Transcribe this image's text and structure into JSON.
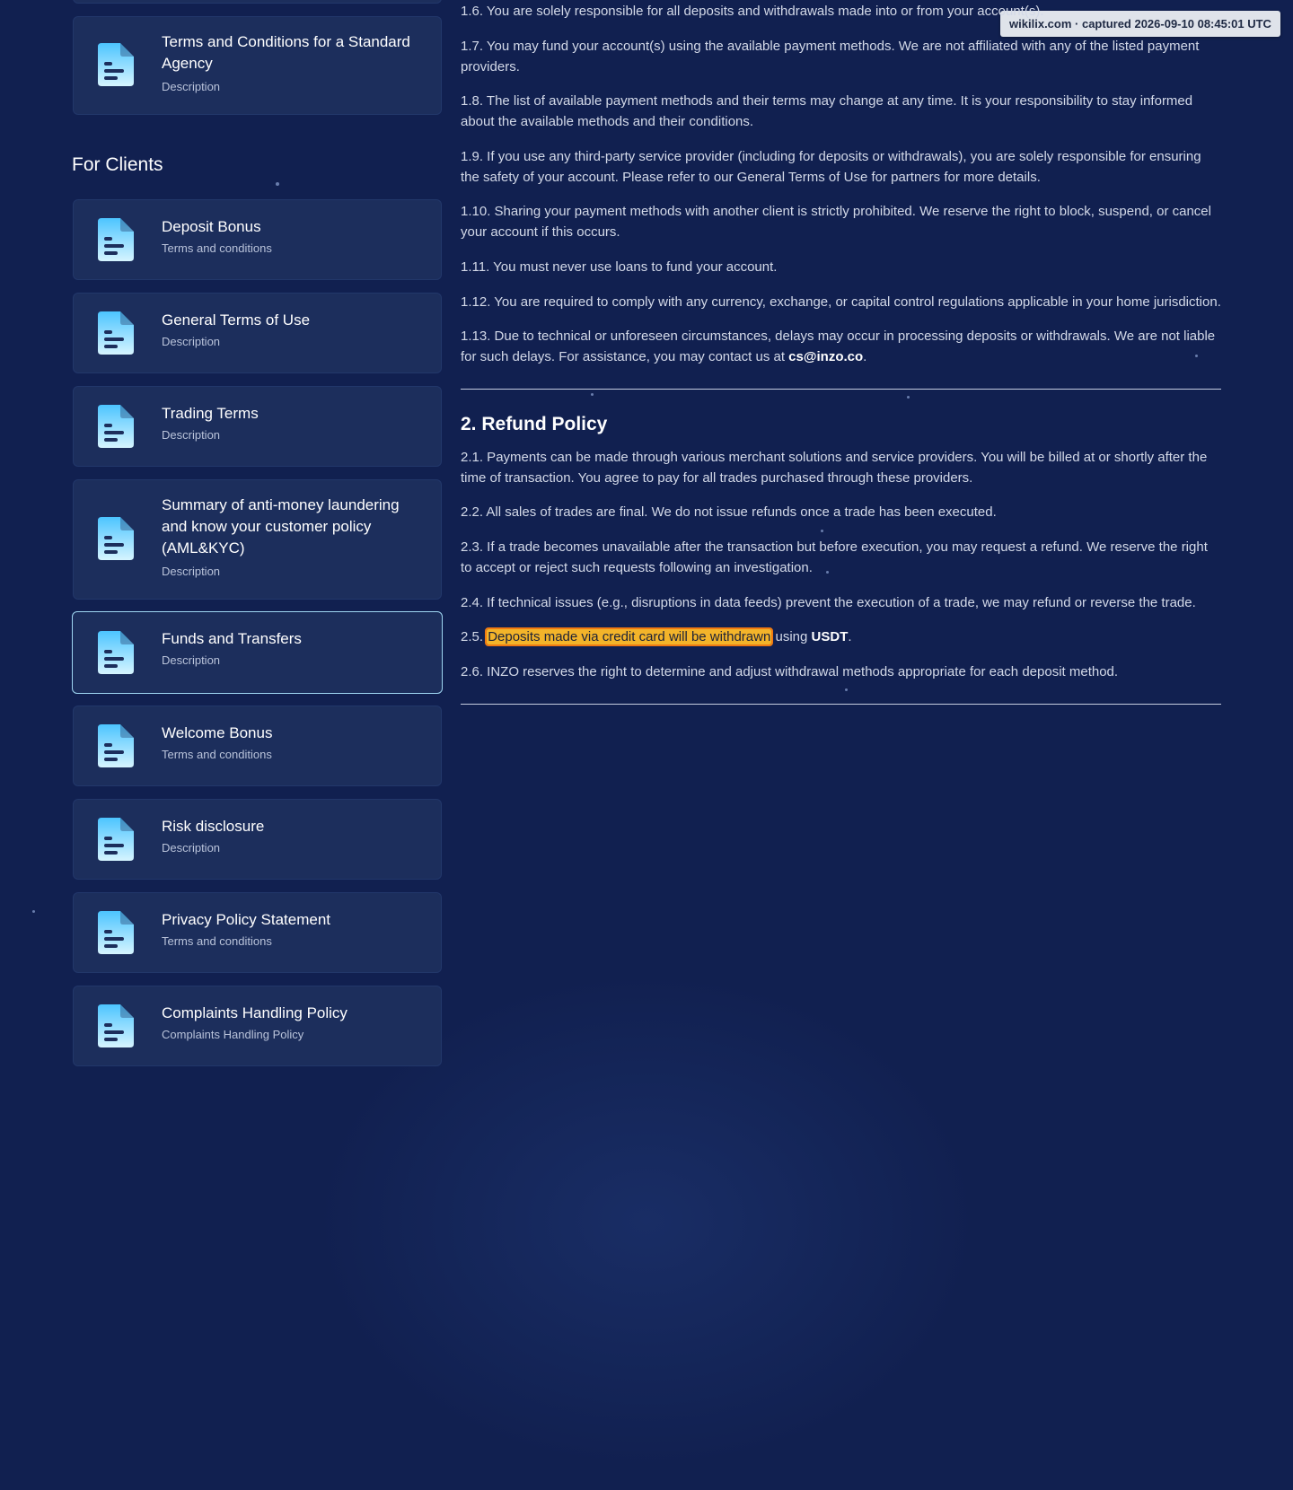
{
  "watermark": "wikilix.com · captured 2026-09-10 08:45:01 UTC",
  "sidebar": {
    "top_card": {
      "title": "Terms and Conditions for a Standard Agency",
      "subtitle": "Description"
    },
    "section_heading": "For Clients",
    "items": [
      {
        "title": "Deposit Bonus",
        "subtitle": "Terms and conditions"
      },
      {
        "title": "General Terms of Use",
        "subtitle": "Description"
      },
      {
        "title": "Trading Terms",
        "subtitle": "Description"
      },
      {
        "title": "Summary of anti-money laundering and know your customer policy (AML&KYC)",
        "subtitle": "Description"
      },
      {
        "title": "Funds and Transfers",
        "subtitle": "Description",
        "active": true
      },
      {
        "title": "Welcome Bonus",
        "subtitle": "Terms and conditions"
      },
      {
        "title": "Risk disclosure",
        "subtitle": "Description"
      },
      {
        "title": "Privacy Policy Statement",
        "subtitle": "Terms and conditions"
      },
      {
        "title": "Complaints Handling Policy",
        "subtitle": "Complaints Handling Policy"
      }
    ]
  },
  "content": {
    "p1_6": "1.6. You are solely responsible for all deposits and withdrawals made into or from your account(s).",
    "p1_7": "1.7. You may fund your account(s) using the available payment methods. We are not affiliated with any of the listed payment providers.",
    "p1_8": "1.8. The list of available payment methods and their terms may change at any time. It is your responsibility to stay informed about the available methods and their conditions.",
    "p1_9": "1.9. If you use any third-party service provider (including for deposits or withdrawals), you are solely responsible for ensuring the safety of your account. Please refer to our General Terms of Use for partners for more details.",
    "p1_10": "1.10. Sharing your payment methods with another client is strictly prohibited. We reserve the right to block, suspend, or cancel your account if this occurs.",
    "p1_11": "1.11. You must never use loans to fund your account.",
    "p1_12": "1.12. You are required to comply with any currency, exchange, or capital control regulations applicable in your home jurisdiction.",
    "p1_13_text": "1.13. Due to technical or unforeseen circumstances, delays may occur in processing deposits or withdrawals. We are not liable for such delays. For assistance, you may contact us at ",
    "p1_13_email": "cs@inzo.co",
    "p1_13_end": ".",
    "refund_heading": "2. Refund Policy",
    "p2_1": "2.1. Payments can be made through various merchant solutions and service providers. You will be billed at or shortly after the time of transaction. You agree to pay for all trades purchased through these providers.",
    "p2_2": "2.2. All sales of trades are final. We do not issue refunds once a trade has been executed.",
    "p2_3": "2.3. If a trade becomes unavailable after the transaction but before execution, you may request a refund. We reserve the right to accept or reject such requests following an investigation.",
    "p2_4": "2.4. If technical issues (e.g., disruptions in data feeds) prevent the execution of a trade, we may refund or reverse the trade.",
    "p2_5_prefix": "2.5. ",
    "p2_5_highlight": "Deposits made via credit card will be withdrawn",
    "p2_5_mid": " using ",
    "p2_5_strong": "USDT",
    "p2_5_end": ".",
    "p2_6": "2.6. INZO reserves the right to determine and adjust withdrawal methods appropriate for each deposit method."
  },
  "colors": {
    "background": "#112050",
    "card": "#1c2e5c",
    "active_border": "#9fd6f2",
    "highlight": "#f3b42a",
    "icon_gradient_top": "#5fd0ff",
    "icon_gradient_bottom": "#c9f0ff"
  },
  "icons": {
    "document": "document-icon"
  }
}
